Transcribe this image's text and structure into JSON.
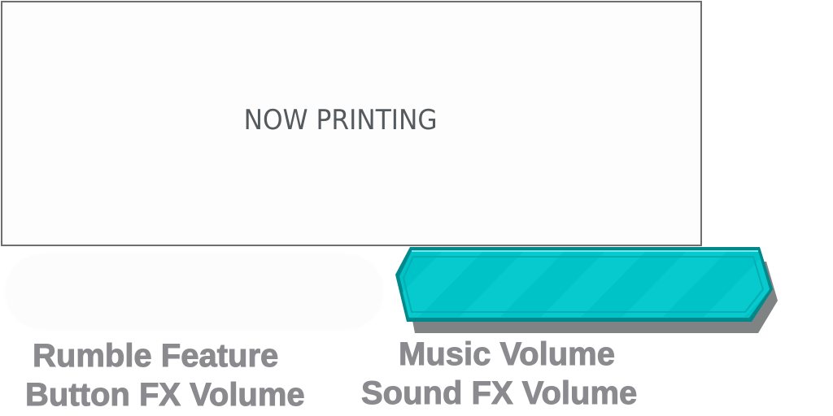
{
  "placeholder": {
    "text": "NOW PRINTING"
  },
  "labels": {
    "rumble_feature": "Rumble Feature",
    "button_fx_volume": "Button FX Volume",
    "music_volume": "Music Volume",
    "sound_fx_volume": "Sound FX Volume"
  },
  "colors": {
    "bar_fill": "#00c3c8",
    "bar_border": "#00888a",
    "bar_shadow": "#7f8383",
    "label_text": "#8a8a8f"
  }
}
